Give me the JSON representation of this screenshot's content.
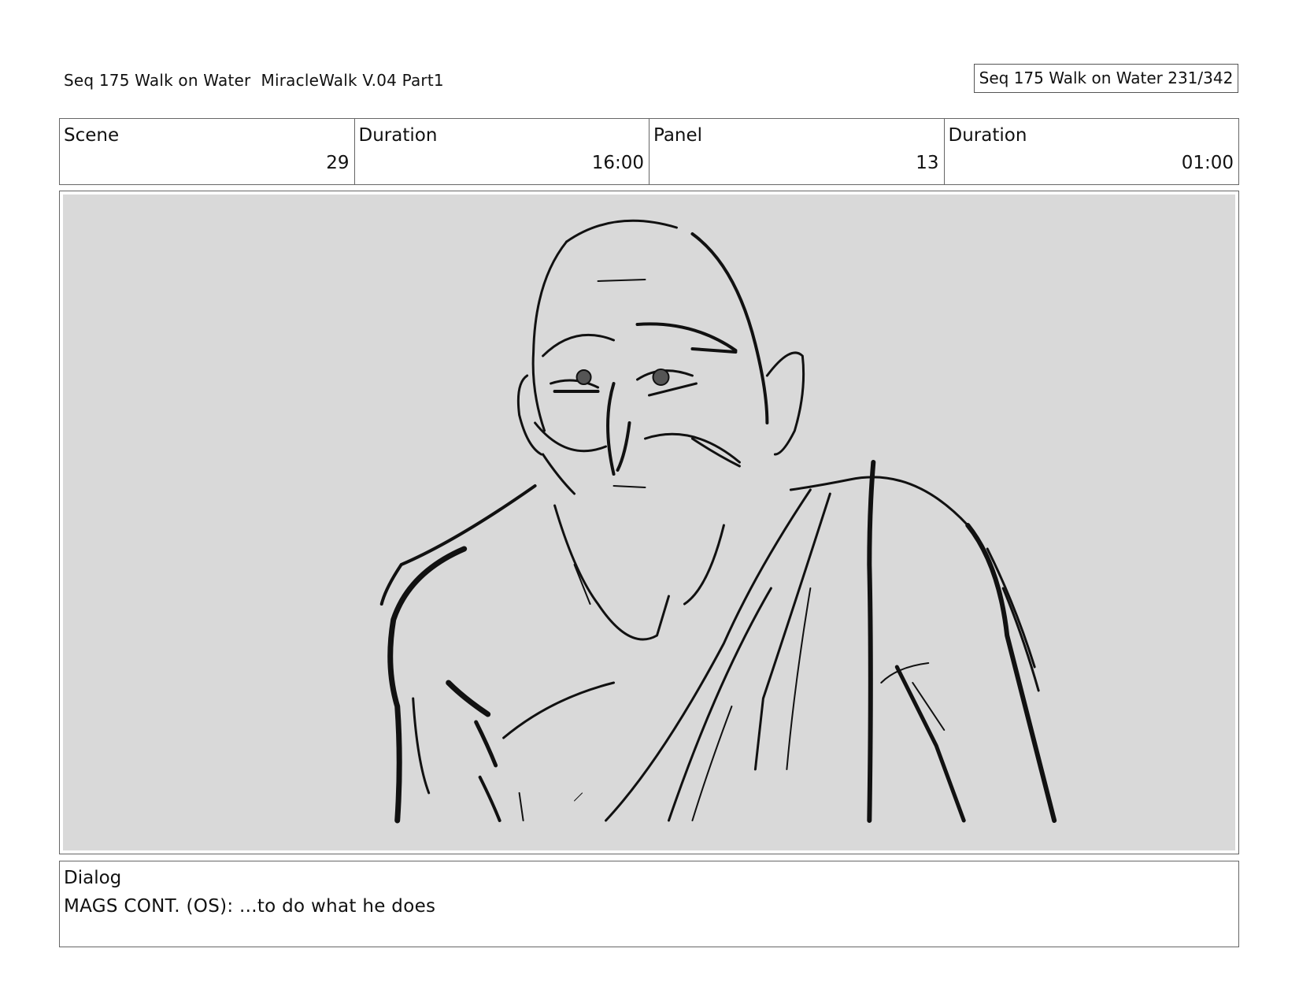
{
  "header": {
    "title": "Seq 175 Walk on Water  MiracleWalk V.04 Part1",
    "page_counter": "Seq 175 Walk on Water 231/342"
  },
  "info": {
    "scene_label": "Scene",
    "scene_value": "29",
    "scene_duration_label": "Duration",
    "scene_duration_value": "16:00",
    "panel_label": "Panel",
    "panel_value": "13",
    "panel_duration_label": "Duration",
    "panel_duration_value": "01:00"
  },
  "panel": {
    "background_color": "#d9d9d9",
    "line_color": "#111111"
  },
  "dialog": {
    "label": "Dialog",
    "text": "MAGS CONT. (OS): ...to do what he does"
  }
}
